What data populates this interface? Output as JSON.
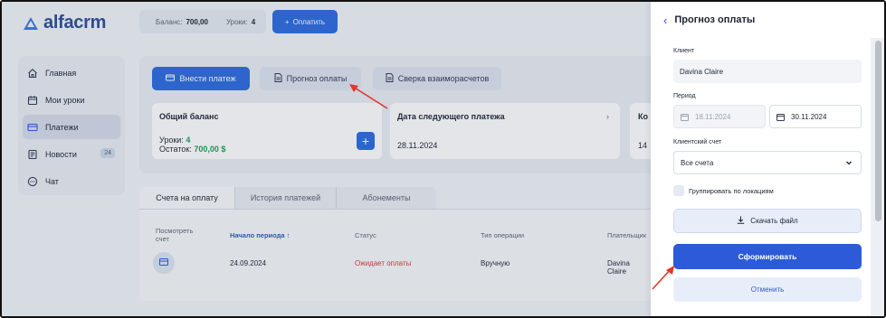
{
  "brand": {
    "name": "alfacrm"
  },
  "header": {
    "balance_label": "Баланс:",
    "balance_value": "700,00",
    "lessons_label": "Уроки:",
    "lessons_value": "4",
    "pay_button": "Оплатить"
  },
  "sidebar": {
    "items": [
      {
        "label": "Главная",
        "icon": "home-icon"
      },
      {
        "label": "Мои уроки",
        "icon": "calendar-icon"
      },
      {
        "label": "Платежи",
        "icon": "card-icon",
        "active": true
      },
      {
        "label": "Новости",
        "icon": "news-icon",
        "badge": "24"
      },
      {
        "label": "Чат",
        "icon": "chat-icon"
      }
    ]
  },
  "actions": {
    "deposit": "Внести платеж",
    "forecast": "Прогноз оплаты",
    "reconciliation": "Сверка взаиморасчетов"
  },
  "cards": {
    "balance_title": "Общий баланс",
    "lessons_line_label": "Уроки:",
    "lessons_line_value": "4",
    "remainder_label": "Остаток:",
    "remainder_value": "700,00 $",
    "next_payment_title": "Дата следующего платежа",
    "next_payment_date": "28.11.2024",
    "third_title": "Ко",
    "third_value": "14"
  },
  "tabs": [
    "Счета на оплату",
    "История платежей",
    "Абонементы"
  ],
  "table": {
    "headers": [
      "Посмотреть счет",
      "Начало периода ↑",
      "Статус",
      "Тип операции",
      "Плательщик"
    ],
    "rows": [
      {
        "start": "24.09.2024",
        "status": "Ожидает оплаты",
        "type": "Вручную",
        "payer": "Davina Claire"
      }
    ]
  },
  "drawer": {
    "title": "Прогноз оплаты",
    "client_label": "Клиент",
    "client_value": "Davina Claire",
    "period_label": "Период",
    "period_from": "18.11.2024",
    "period_to": "30.11.2024",
    "account_label": "Клиентский счет",
    "account_value": "Все счета",
    "group_label": "Группировать по локациям",
    "group_checked": false,
    "download_button": "Скачать файл",
    "generate_button": "Сформировать",
    "cancel_button": "Отменить"
  },
  "colors": {
    "primary": "#2c6be0",
    "brand": "#2a4f94",
    "status_pending": "#d43a3a",
    "positive": "#1f9d55",
    "annotation_arrow": "#e0372c"
  }
}
